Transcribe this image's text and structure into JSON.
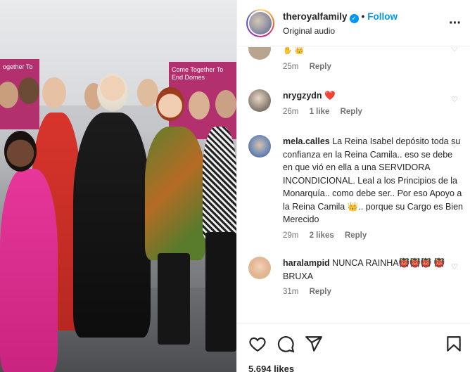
{
  "header": {
    "username": "theroyalfamily",
    "follow_label": "Follow",
    "subtitle": "Original audio"
  },
  "photo": {
    "banner_left_text": "ogether To",
    "banner_right_text": "Come Together To End Domes"
  },
  "comments": [
    {
      "time": "25m",
      "reply": "Reply"
    },
    {
      "username": "nrygzydn",
      "text": "❤️",
      "time": "26m",
      "likes": "1 like",
      "reply": "Reply"
    },
    {
      "username": "mela.calles",
      "text": "La Reina Isabel depósito toda su confianza en la Reina Camila.. eso se debe en que vió en ella a una SERVIDORA INCONDICIONAL. Leal a los Principios de la Monarquía.. como debe ser.. Por eso Apoyo a la Reina Camila 👑.. porque su Cargo es Bien Merecido",
      "time": "29m",
      "likes": "2 likes",
      "reply": "Reply"
    },
    {
      "username": "haralampid",
      "text": "NUNCA RAINHA👹👹👹 👹BRUXA",
      "time": "31m",
      "reply": "Reply"
    }
  ],
  "footer": {
    "likes": "5.694 likes"
  },
  "icons": [
    "verified-icon",
    "more-icon",
    "heart-icon",
    "comment-icon",
    "share-icon",
    "bookmark-icon"
  ],
  "colors": {
    "accent": "#0095f6",
    "banner": "#b2306d"
  }
}
